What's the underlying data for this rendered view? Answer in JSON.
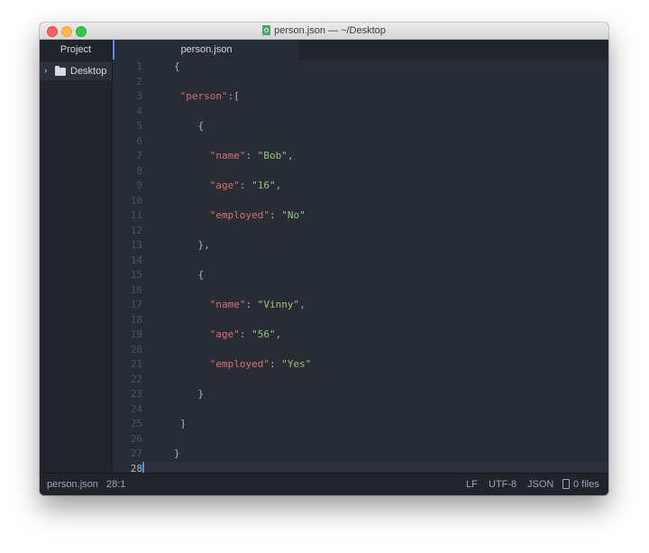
{
  "window": {
    "title": "person.json — ~/Desktop",
    "buttons": [
      "close",
      "minimize",
      "zoom"
    ]
  },
  "tabs": {
    "project_label": "Project",
    "file_label": "person.json"
  },
  "tree": {
    "root_label": "Desktop"
  },
  "editor": {
    "line_numbers": [
      "1",
      "2",
      "3",
      "4",
      "5",
      "6",
      "7",
      "8",
      "9",
      "10",
      "11",
      "12",
      "13",
      "14",
      "15",
      "16",
      "17",
      "18",
      "19",
      "20",
      "21",
      "22",
      "23",
      "24",
      "25",
      "26",
      "27",
      "28"
    ],
    "current_line": 28,
    "code": {
      "l1_brace": "{",
      "l3_key": "\"person\"",
      "l3_rest": ":[",
      "l5_brace": "{",
      "l7_key": "\"name\"",
      "l7_colon": ": ",
      "l7_val": "\"Bob\"",
      "l7_comma": ",",
      "l9_key": "\"age\"",
      "l9_colon": ": ",
      "l9_val": "\"16\"",
      "l9_comma": ",",
      "l11_key": "\"employed\"",
      "l11_colon": ": ",
      "l11_val": "\"No\"",
      "l13_close": "},",
      "l15_brace": "{",
      "l17_key": "\"name\"",
      "l17_colon": ": ",
      "l17_val": "\"Vinny\"",
      "l17_comma": ",",
      "l19_key": "\"age\"",
      "l19_colon": ": ",
      "l19_val": "\"56\"",
      "l19_comma": ",",
      "l21_key": "\"employed\"",
      "l21_colon": ": ",
      "l21_val": "\"Yes\"",
      "l23_close": "}",
      "l25_bracket": "]",
      "l27_brace": "}"
    }
  },
  "statusbar": {
    "file": "person.json",
    "cursor": "28:1",
    "line_ending": "LF",
    "encoding": "UTF-8",
    "grammar": "JSON",
    "git": "0 files"
  },
  "colors": {
    "background": "#282c34",
    "panel": "#21252b",
    "key": "#e06c75",
    "string": "#98c379",
    "text": "#abb2bf",
    "accent": "#528bff"
  }
}
